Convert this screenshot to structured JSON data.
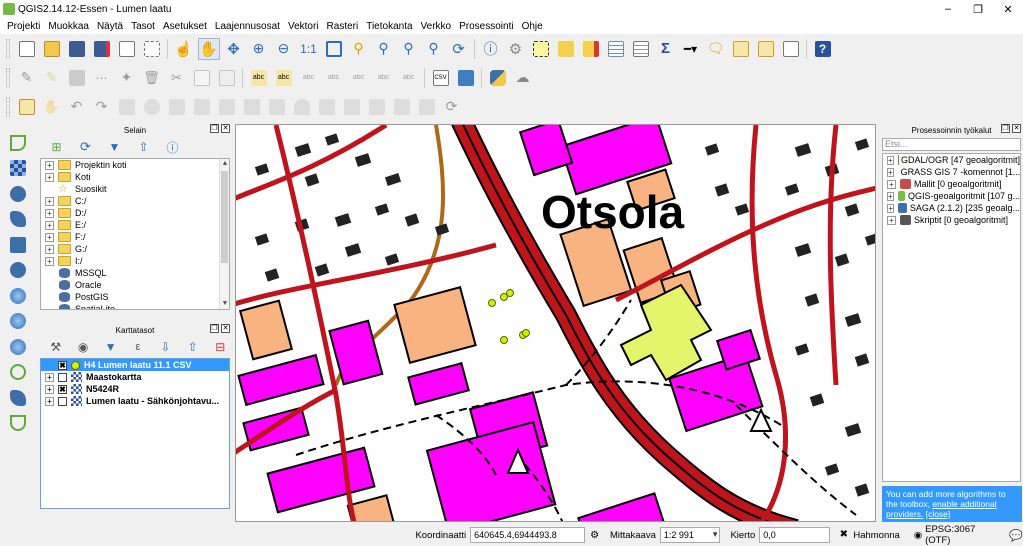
{
  "window": {
    "title": "QGIS2.14.12-Essen - Lumen laatu",
    "controls": [
      "minimize",
      "maximize",
      "close"
    ]
  },
  "menu": [
    "Projekti",
    "Muokkaa",
    "Näytä",
    "Tasot",
    "Asetukset",
    "Laajennusosat",
    "Vektori",
    "Rasteri",
    "Tietokanta",
    "Verkko",
    "Prosessointi",
    "Ohje"
  ],
  "browser_panel": {
    "title": "Selain",
    "items": [
      {
        "label": "Projektin koti",
        "kind": "folder",
        "expandable": true
      },
      {
        "label": "Koti",
        "kind": "folder",
        "expandable": true
      },
      {
        "label": "Suosikit",
        "kind": "star",
        "expandable": false
      },
      {
        "label": "C:/",
        "kind": "folder",
        "expandable": true
      },
      {
        "label": "D:/",
        "kind": "folder",
        "expandable": true
      },
      {
        "label": "E:/",
        "kind": "folder",
        "expandable": true
      },
      {
        "label": "F:/",
        "kind": "folder",
        "expandable": true
      },
      {
        "label": "G:/",
        "kind": "folder",
        "expandable": true
      },
      {
        "label": "I:/",
        "kind": "folder",
        "expandable": true
      },
      {
        "label": "MSSQL",
        "kind": "db",
        "expandable": false
      },
      {
        "label": "Oracle",
        "kind": "db",
        "expandable": false
      },
      {
        "label": "PostGIS",
        "kind": "db",
        "expandable": false
      },
      {
        "label": "SpatiaLite",
        "kind": "db",
        "expandable": false
      }
    ]
  },
  "layers_panel": {
    "title": "Karttatasot",
    "layers": [
      {
        "label": "H4 Lumen laatu 11.1 CSV",
        "checked": true,
        "selected": true,
        "icon": "point-layer-icon"
      },
      {
        "label": "Maastokartta",
        "checked": false,
        "selected": false,
        "icon": "raster-layer-icon"
      },
      {
        "label": "N5424R",
        "checked": true,
        "selected": false,
        "icon": "raster-layer-icon"
      },
      {
        "label": "Lumen laatu - Sähkönjohtavu...",
        "checked": false,
        "selected": false,
        "icon": "raster-layer-icon"
      }
    ]
  },
  "map": {
    "place_label": "Otsola",
    "colors": {
      "road_red": "#c0141c",
      "building_magenta": "#ff00ff",
      "building_orange": "#f8b380",
      "building_yellow": "#e5f56b",
      "small_building": "#222222",
      "path_brown": "#b06818",
      "point_yellow": "#d4f000"
    }
  },
  "processing_panel": {
    "title": "Prosessoinnin työkalut",
    "search_placeholder": "Etsi...",
    "providers": [
      {
        "label": "GDAL/OGR [47 geoalgoritmit]",
        "color": "#5b8f3a"
      },
      {
        "label": "GRASS GIS 7 -komennot [1...",
        "color": "#6a9a3c"
      },
      {
        "label": "Mallit [0 geoalgoritmit]",
        "color": "#c84b4b"
      },
      {
        "label": "QGIS-geoalgoritmit [107 g...",
        "color": "#7bbf3f"
      },
      {
        "label": "SAGA (2.1.2) [235 geoalg...",
        "color": "#3a6fb0"
      },
      {
        "label": "Skriptit [0 geoalgoritmit]",
        "color": "#555555"
      }
    ],
    "note_text": "You can add more algorithms to the toolbox,",
    "note_link": "enable additional providers.",
    "note_close": "[close]"
  },
  "statusbar": {
    "coord_label": "Koordinaatti",
    "coord_value": "640645.4,6944493.8",
    "scale_label": "Mittakaava",
    "scale_value": "1:2 991",
    "rotation_label": "Kierto",
    "rotation_value": "0,0",
    "render_label": "Hahmonna",
    "render_checked": true,
    "crs_label": "EPSG:3067 (OTF)"
  }
}
